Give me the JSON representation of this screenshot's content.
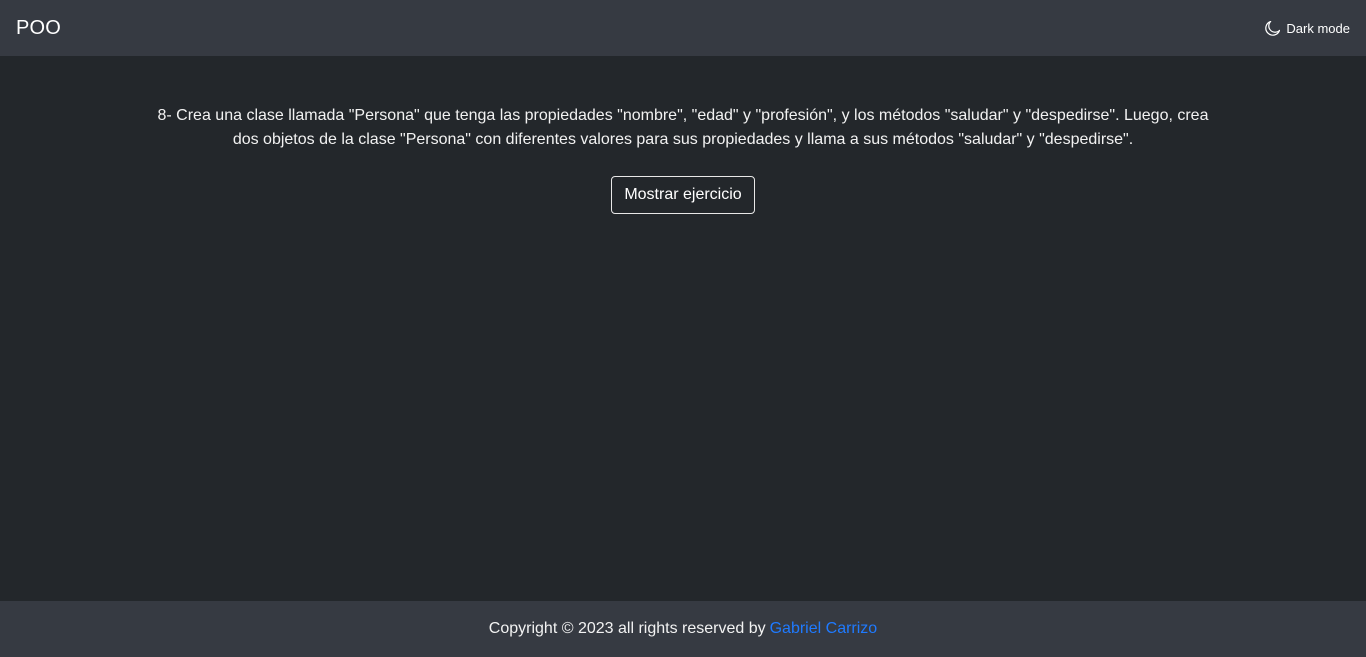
{
  "navbar": {
    "brand": "POO",
    "theme_toggle": {
      "icon": "moon-icon",
      "label": "Dark mode"
    }
  },
  "main": {
    "exercise_text": "8- Crea una clase llamada \"Persona\" que tenga las propiedades \"nombre\", \"edad\" y \"profesión\", y los métodos \"saludar\" y \"despedirse\". Luego, crea dos objetos de la clase \"Persona\" con diferentes valores para sus propiedades y llama a sus métodos \"saludar\" y \"despedirse\".",
    "button_label": "Mostrar ejercicio"
  },
  "footer": {
    "copyright_text": "Copyright © 2023 all rights reserved by",
    "author_link": "Gabriel Carrizo"
  },
  "colors": {
    "navbar_bg": "#363a42",
    "main_bg": "#23272b",
    "link": "#1f7aff"
  }
}
